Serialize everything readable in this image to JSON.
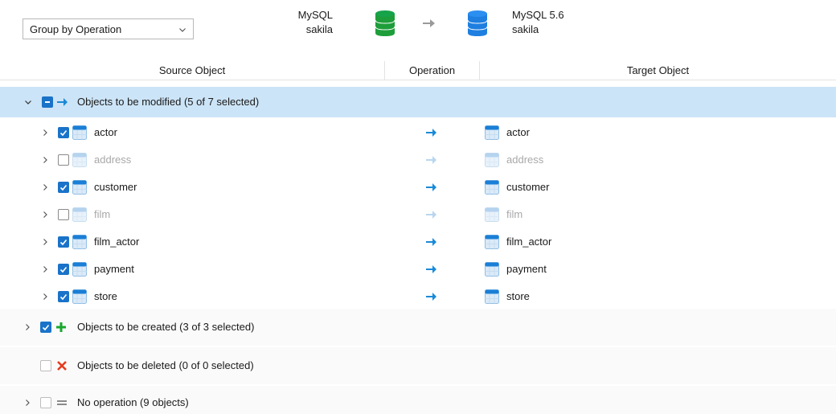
{
  "toolbar": {
    "group_by": "Group by Operation"
  },
  "source": {
    "server": "MySQL",
    "schema": "sakila",
    "color": "#1e9e3a"
  },
  "target": {
    "server": "MySQL 5.6",
    "schema": "sakila",
    "color": "#1e7fe0"
  },
  "columns": {
    "source": "Source Object",
    "operation": "Operation",
    "target": "Target Object"
  },
  "groups": {
    "modified": {
      "label": "Objects to be modified (5 of 7 selected)"
    },
    "created": {
      "label": "Objects to be created (3 of 3 selected)"
    },
    "deleted": {
      "label": "Objects to be deleted (0 of 0 selected)"
    },
    "noop": {
      "label": "No operation (9 objects)"
    }
  },
  "rows": [
    {
      "name": "actor",
      "checked": true
    },
    {
      "name": "address",
      "checked": false
    },
    {
      "name": "customer",
      "checked": true
    },
    {
      "name": "film",
      "checked": false
    },
    {
      "name": "film_actor",
      "checked": true
    },
    {
      "name": "payment",
      "checked": true
    },
    {
      "name": "store",
      "checked": true
    }
  ]
}
